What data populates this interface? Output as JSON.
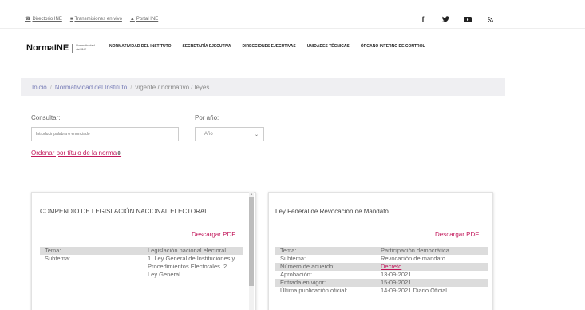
{
  "utility": {
    "links": [
      {
        "label": "Directorio INE",
        "icon": "directory-icon"
      },
      {
        "label": "Transmisiones en vivo",
        "icon": "video-icon"
      },
      {
        "label": "Portal INE",
        "icon": "home-icon"
      }
    ],
    "socials": [
      "f",
      "t",
      "yt",
      "rss"
    ]
  },
  "logo": {
    "text": "NormaINE",
    "subtitle": "Normatividad del INE"
  },
  "nav": [
    "NORMATIVIDAD DEL INSTITUTO",
    "SECRETARÍA EJECUTIVA",
    "DIRECCIONES EJECUTIVAS",
    "UNIDADES TÉCNICAS",
    "ÓRGANO INTERNO DE CONTROL"
  ],
  "breadcrumb": {
    "home": "Inicio",
    "section": "Normatividad del Instituto",
    "path": "vigente / normativo / leyes"
  },
  "search": {
    "label": "Consultar:",
    "placeholder": "Introducir palabra o enunciado"
  },
  "year": {
    "label": "Por año:",
    "value": "Año"
  },
  "sort": {
    "label": "Ordenar por título de la norma"
  },
  "cards": [
    {
      "title": "COMPENDIO DE LEGISLACIÓN NACIONAL ELECTORAL",
      "download": "Descargar PDF",
      "rows": [
        {
          "k": "Tema:",
          "v": "Legislación nacional electoral"
        },
        {
          "k": "Subtema:",
          "v": "1. Ley General de Instituciones y Procedimientos Electorales. 2. Ley General"
        }
      ]
    },
    {
      "title": "Ley Federal de Revocación de Mandato",
      "download": "Descargar PDF",
      "rows": [
        {
          "k": "Tema:",
          "v": "Participación democrática"
        },
        {
          "k": "Subtema:",
          "v": "Revocación de mandato"
        },
        {
          "k": "Número de acuerdo:",
          "v": "Decreto"
        },
        {
          "k": "Aprobación:",
          "v": "13-09-2021"
        },
        {
          "k": "Entrada en vigor:",
          "v": "15-09-2021"
        },
        {
          "k": "Última publicación oficial:",
          "v": "14-09-2021 Diario Oficial"
        }
      ]
    }
  ],
  "colors": {
    "accent": "#c2185b",
    "breadcrumb_bg": "#efeff2",
    "row_shade": "#dcdcdc"
  }
}
